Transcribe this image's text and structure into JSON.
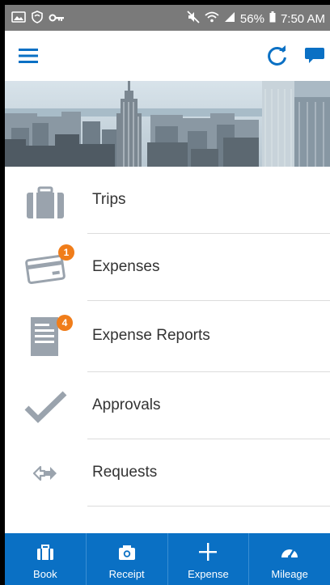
{
  "status_bar": {
    "battery": "56%",
    "time": "7:50 AM"
  },
  "app_bar": {
    "menu_icon": "hamburger-menu-icon",
    "refresh_icon": "refresh-icon",
    "chat_icon": "chat-bubble-icon"
  },
  "menu": [
    {
      "label": "Trips",
      "icon": "suitcase-icon",
      "badge": ""
    },
    {
      "label": "Expenses",
      "icon": "credit-card-icon",
      "badge": "1"
    },
    {
      "label": "Expense Reports",
      "icon": "report-document-icon",
      "badge": "4"
    },
    {
      "label": "Approvals",
      "icon": "checkmark-icon",
      "badge": ""
    },
    {
      "label": "Requests",
      "icon": "arrows-exchange-icon",
      "badge": ""
    }
  ],
  "bottom_tabs": [
    {
      "label": "Book",
      "icon": "suitcase-icon"
    },
    {
      "label": "Receipt",
      "icon": "camera-icon"
    },
    {
      "label": "Expense",
      "icon": "plus-icon"
    },
    {
      "label": "Mileage",
      "icon": "speedometer-icon"
    }
  ],
  "colors": {
    "accent": "#0a70c4",
    "badge": "#f07d1a",
    "icon_gray": "#9aa3ad",
    "status_bar": "#7a7a7a"
  }
}
